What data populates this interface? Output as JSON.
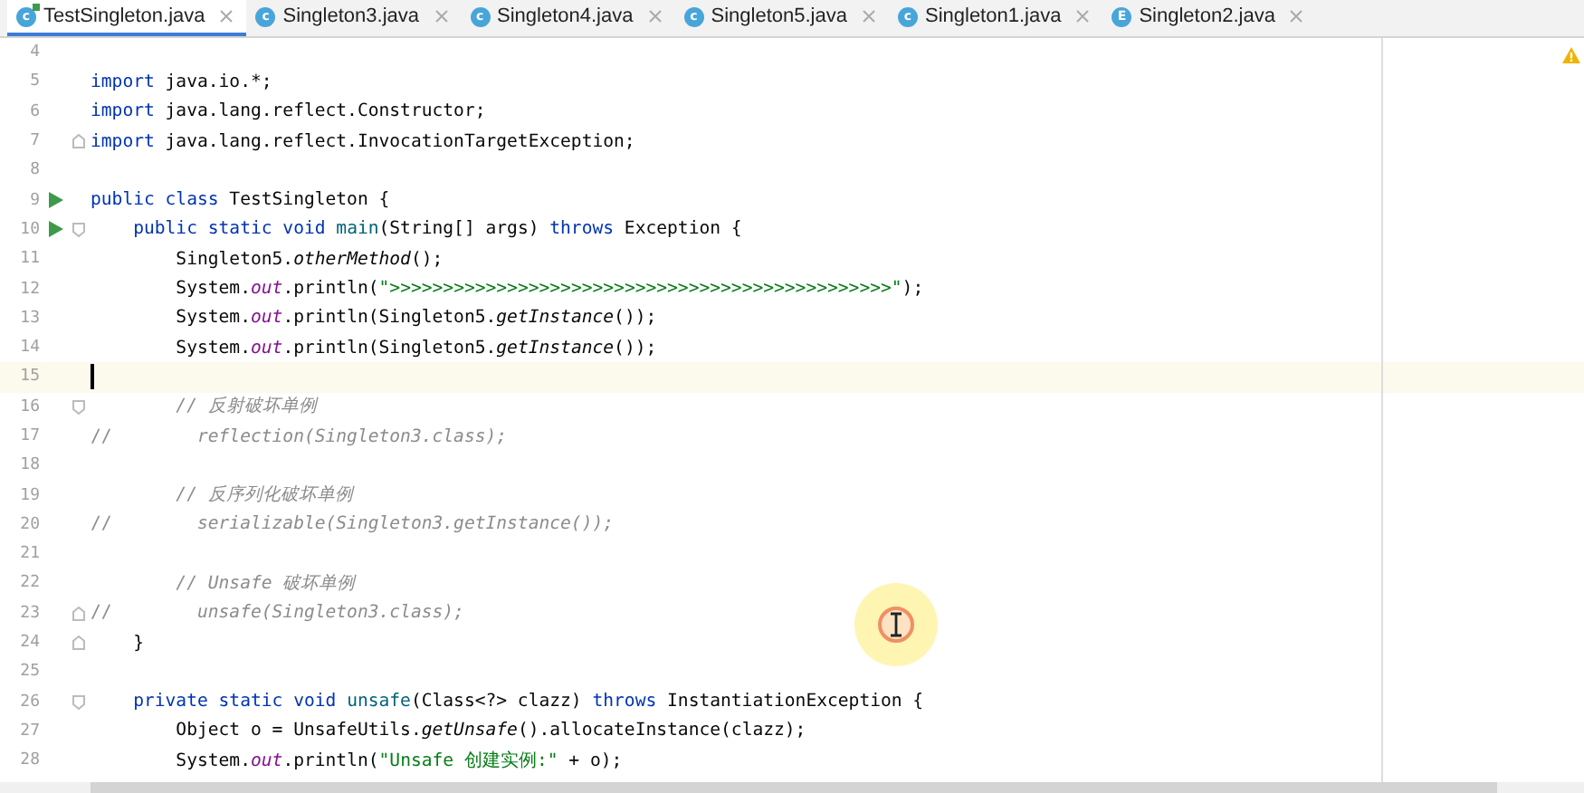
{
  "tabs": [
    {
      "icon": "c",
      "label": "TestSingleton.java",
      "runnable": true,
      "selected": true
    },
    {
      "icon": "c",
      "label": "Singleton3.java",
      "runnable": false,
      "selected": false
    },
    {
      "icon": "c",
      "label": "Singleton4.java",
      "runnable": false,
      "selected": false
    },
    {
      "icon": "c",
      "label": "Singleton5.java",
      "runnable": false,
      "selected": false
    },
    {
      "icon": "c",
      "label": "Singleton1.java",
      "runnable": false,
      "selected": false
    },
    {
      "icon": "E",
      "label": "Singleton2.java",
      "runnable": false,
      "selected": false
    }
  ],
  "lines": [
    {
      "number": "4",
      "current": false
    },
    {
      "number": "5",
      "current": false,
      "tokens": [
        {
          "kind": "kw",
          "text": "import"
        },
        {
          "kind": "plain",
          "text": " java.io.*;"
        }
      ]
    },
    {
      "number": "6",
      "current": false,
      "tokens": [
        {
          "kind": "kw",
          "text": "import"
        },
        {
          "kind": "plain",
          "text": " java.lang.reflect.Constructor;"
        }
      ]
    },
    {
      "number": "7",
      "current": false,
      "gutter": [
        {
          "kind": "fold-end"
        }
      ],
      "tokens": [
        {
          "kind": "kw",
          "text": "import"
        },
        {
          "kind": "plain",
          "text": " java.lang.reflect.InvocationTargetException;"
        }
      ]
    },
    {
      "number": "8",
      "current": false
    },
    {
      "number": "9",
      "current": false,
      "gutter": [
        {
          "kind": "run"
        }
      ],
      "tokens": [
        {
          "kind": "kw",
          "text": "public class"
        },
        {
          "kind": "plain",
          "text": " TestSingleton {"
        }
      ]
    },
    {
      "number": "10",
      "current": false,
      "gutter": [
        {
          "kind": "run"
        },
        {
          "kind": "fold-start"
        }
      ],
      "tokens": [
        {
          "kind": "kw",
          "text": "    public static void "
        },
        {
          "kind": "decl",
          "text": "main"
        },
        {
          "kind": "plain",
          "text": "(String[] args) "
        },
        {
          "kind": "kw",
          "text": "throws"
        },
        {
          "kind": "plain",
          "text": " Exception {"
        }
      ]
    },
    {
      "number": "11",
      "current": false,
      "tokens": [
        {
          "kind": "plain",
          "text": "        Singleton5."
        },
        {
          "kind": "italic",
          "text": "otherMethod"
        },
        {
          "kind": "plain",
          "text": "();"
        }
      ]
    },
    {
      "number": "12",
      "current": false,
      "tokens": [
        {
          "kind": "plain",
          "text": "        System."
        },
        {
          "kind": "static",
          "text": "out"
        },
        {
          "kind": "plain",
          "text": ".println("
        },
        {
          "kind": "string",
          "text": "\">>>>>>>>>>>>>>>>>>>>>>>>>>>>>>>>>>>>>>>>>>>>>>>\""
        },
        {
          "kind": "plain",
          "text": ");"
        }
      ]
    },
    {
      "number": "13",
      "current": false,
      "tokens": [
        {
          "kind": "plain",
          "text": "        System."
        },
        {
          "kind": "static",
          "text": "out"
        },
        {
          "kind": "plain",
          "text": ".println(Singleton5."
        },
        {
          "kind": "italic",
          "text": "getInstance"
        },
        {
          "kind": "plain",
          "text": "());"
        }
      ]
    },
    {
      "number": "14",
      "current": false,
      "tokens": [
        {
          "kind": "plain",
          "text": "        System."
        },
        {
          "kind": "static",
          "text": "out"
        },
        {
          "kind": "plain",
          "text": ".println(Singleton5."
        },
        {
          "kind": "italic",
          "text": "getInstance"
        },
        {
          "kind": "plain",
          "text": "());"
        }
      ]
    },
    {
      "number": "15",
      "current": true
    },
    {
      "number": "16",
      "current": false,
      "gutter": [
        {
          "kind": "fold-start"
        }
      ],
      "tokens": [
        {
          "kind": "comment",
          "text": "        // 反射破坏单例"
        }
      ]
    },
    {
      "number": "17",
      "current": false,
      "tokens": [
        {
          "kind": "comment-mark",
          "text": "//"
        },
        {
          "kind": "comment",
          "text": "        reflection(Singleton3.class);"
        }
      ]
    },
    {
      "number": "18",
      "current": false
    },
    {
      "number": "19",
      "current": false,
      "tokens": [
        {
          "kind": "comment",
          "text": "        // 反序列化破坏单例"
        }
      ]
    },
    {
      "number": "20",
      "current": false,
      "tokens": [
        {
          "kind": "comment-mark",
          "text": "//"
        },
        {
          "kind": "comment",
          "text": "        serializable(Singleton3.getInstance());"
        }
      ]
    },
    {
      "number": "21",
      "current": false
    },
    {
      "number": "22",
      "current": false,
      "tokens": [
        {
          "kind": "comment",
          "text": "        // Unsafe 破坏单例"
        }
      ]
    },
    {
      "number": "23",
      "current": false,
      "gutter": [
        {
          "kind": "fold-end"
        }
      ],
      "tokens": [
        {
          "kind": "comment-mark",
          "text": "//"
        },
        {
          "kind": "comment",
          "text": "        unsafe(Singleton3.class);"
        }
      ]
    },
    {
      "number": "24",
      "current": false,
      "gutter": [
        {
          "kind": "fold-end"
        }
      ],
      "tokens": [
        {
          "kind": "plain",
          "text": "    }"
        }
      ]
    },
    {
      "number": "25",
      "current": false
    },
    {
      "number": "26",
      "current": false,
      "gutter": [
        {
          "kind": "fold-start"
        }
      ],
      "tokens": [
        {
          "kind": "kw",
          "text": "    private static void "
        },
        {
          "kind": "decl",
          "text": "unsafe"
        },
        {
          "kind": "plain",
          "text": "(Class<?> clazz) "
        },
        {
          "kind": "kw",
          "text": "throws"
        },
        {
          "kind": "plain",
          "text": " InstantiationException {"
        }
      ]
    },
    {
      "number": "27",
      "current": false,
      "tokens": [
        {
          "kind": "plain",
          "text": "        Object o = UnsafeUtils."
        },
        {
          "kind": "italic",
          "text": "getUnsafe"
        },
        {
          "kind": "plain",
          "text": "().allocateInstance(clazz);"
        }
      ]
    },
    {
      "number": "28",
      "current": false,
      "tokens": [
        {
          "kind": "plain",
          "text": "        System."
        },
        {
          "kind": "static",
          "text": "out"
        },
        {
          "kind": "plain",
          "text": ".println("
        },
        {
          "kind": "string",
          "text": "\"Unsafe 创建实例:\""
        },
        {
          "kind": "plain",
          "text": " + o);"
        }
      ]
    }
  ]
}
